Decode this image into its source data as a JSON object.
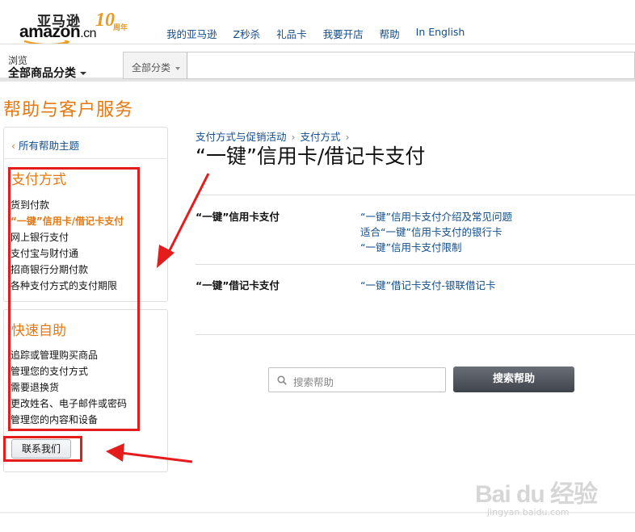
{
  "header": {
    "logo_cn": "亚马逊",
    "logo_en": "amazon",
    "logo_domain": ".cn",
    "anniversary": "10",
    "anniversary_sub": "周年",
    "nav": [
      "我的亚马逊",
      "Z秒杀",
      "礼品卡",
      "我要开店",
      "帮助",
      "In English"
    ]
  },
  "browse": {
    "small": "浏览",
    "big": "全部商品分类",
    "category_select": "全部分类"
  },
  "page_title": "帮助与客户服务",
  "sidebar": {
    "back_link": "所有帮助主题",
    "payment": {
      "heading": "支付方式",
      "items": [
        {
          "label": "货到付款",
          "active": false
        },
        {
          "label": "“一键”信用卡/借记卡支付",
          "active": true
        },
        {
          "label": "网上银行支付",
          "active": false
        },
        {
          "label": "支付宝与财付通",
          "active": false
        },
        {
          "label": "招商银行分期付款",
          "active": false
        },
        {
          "label": "各种支付方式的支付期限",
          "active": false
        }
      ]
    },
    "self_service": {
      "heading": "快速自助",
      "items": [
        "追踪或管理购买商品",
        "管理您的支付方式",
        "需要退换货",
        "更改姓名、电子邮件或密码",
        "管理您的内容和设备"
      ]
    },
    "contact_button": "联系我们"
  },
  "main": {
    "breadcrumb": [
      "支付方式与促销活动",
      "支付方式"
    ],
    "title": "“一键”信用卡/借记卡支付",
    "rows": [
      {
        "label": "“一键”信用卡支付",
        "links": [
          "“一键”信用卡支付介绍及常见问题",
          "适合“一键”信用卡支付的银行卡",
          "“一键”信用卡支付限制"
        ]
      },
      {
        "label": "“一键”借记卡支付",
        "links": [
          "“一键”借记卡支付-银联借记卡"
        ]
      }
    ],
    "search_placeholder": "搜索帮助",
    "search_button": "搜索帮助"
  },
  "watermark": {
    "logo": "Bai du 经验",
    "url": "jingyan.baidu.com"
  },
  "colors": {
    "accent": "#e47911",
    "link": "#114d8c",
    "annotation": "#e41c1c"
  }
}
